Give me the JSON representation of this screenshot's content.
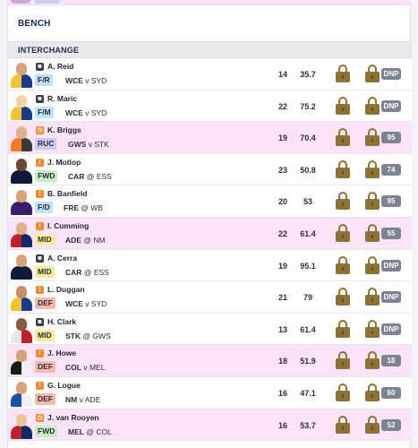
{
  "bench": {
    "label": "BENCH"
  },
  "section": {
    "label": "INTERCHANGE"
  },
  "colors": {
    "row_highlight": "#fbe4f8",
    "lock_gold": "#8c7236",
    "badge_grey": "#7c8392",
    "title_navy": "#1a2a6c"
  },
  "players": [
    {
      "status_icon": "camera-icon",
      "name": "A. Reid",
      "pos": "F/R",
      "pos_key": "FR",
      "team": "WCE",
      "sep": "v",
      "opp": "SYD",
      "rounds": "14",
      "avg": "35.7",
      "badge": "DNP",
      "highlight": false,
      "colors": [
        "#f2c230",
        "#1a3a8a"
      ],
      "skin": "#d9a37a"
    },
    {
      "status_icon": "camera-icon",
      "name": "R. Maric",
      "pos": "F/M",
      "pos_key": "FM",
      "team": "WCE",
      "sep": "v",
      "opp": "SYD",
      "rounds": "22",
      "avg": "75.2",
      "badge": "DNP",
      "highlight": false,
      "colors": [
        "#f2c230",
        "#1a3a8a"
      ],
      "skin": "#f1d3a8"
    },
    {
      "status_icon": "clock-icon",
      "name": "K. Briggs",
      "pos": "RUC",
      "pos_key": "RUC",
      "team": "GWS",
      "sep": "v",
      "opp": "STK",
      "rounds": "19",
      "avg": "70.4",
      "badge": "95",
      "highlight": true,
      "colors": [
        "#f47a20",
        "#3b3b3b"
      ],
      "skin": "#e0b08c"
    },
    {
      "status_icon": "warning-icon",
      "name": "J. Motlop",
      "pos": "FWD",
      "pos_key": "FWD",
      "team": "CAR",
      "sep": "@",
      "opp": "ESS",
      "rounds": "23",
      "avg": "50.8",
      "badge": "74",
      "highlight": false,
      "colors": [
        "#0e1a3a",
        "#0e1a3a"
      ],
      "skin": "#6b4a35"
    },
    {
      "status_icon": "warning-icon",
      "name": "B. Banfield",
      "pos": "F/D",
      "pos_key": "FD",
      "team": "FRE",
      "sep": "@",
      "opp": "WB",
      "rounds": "20",
      "avg": "53",
      "badge": "95",
      "highlight": false,
      "colors": [
        "#3a1e6e",
        "#3a1e6e"
      ],
      "skin": "#d9a37a"
    },
    {
      "status_icon": "warning-icon",
      "name": "I. Cumming",
      "pos": "MID",
      "pos_key": "MID",
      "team": "ADE",
      "sep": "@",
      "opp": "NM",
      "rounds": "22",
      "avg": "61.4",
      "badge": "55",
      "highlight": true,
      "colors": [
        "#c0202a",
        "#0e2a6a"
      ],
      "skin": "#e0b08c"
    },
    {
      "status_icon": "camera-icon",
      "name": "A. Cerra",
      "pos": "MID",
      "pos_key": "MID",
      "team": "CAR",
      "sep": "@",
      "opp": "ESS",
      "rounds": "19",
      "avg": "95.1",
      "badge": "DNP",
      "highlight": false,
      "colors": [
        "#0e1a3a",
        "#0e1a3a"
      ],
      "skin": "#d9a37a"
    },
    {
      "status_icon": "warning-icon",
      "name": "L. Duggan",
      "pos": "DEF",
      "pos_key": "DEF",
      "team": "WCE",
      "sep": "v",
      "opp": "SYD",
      "rounds": "21",
      "avg": "79",
      "badge": "DNP",
      "highlight": false,
      "colors": [
        "#f2c230",
        "#1a3a8a"
      ],
      "skin": "#c98d66"
    },
    {
      "status_icon": "camera-icon",
      "name": "H. Clark",
      "pos": "MID",
      "pos_key": "MID",
      "team": "STK",
      "sep": "@",
      "opp": "GWS",
      "rounds": "13",
      "avg": "61.4",
      "badge": "DNP",
      "highlight": false,
      "colors": [
        "#e8e8e8",
        "#c0202a"
      ],
      "skin": "#8a5b40"
    },
    {
      "status_icon": "warning-icon",
      "name": "J. Howe",
      "pos": "DEF",
      "pos_key": "DEF",
      "team": "COL",
      "sep": "v",
      "opp": "MEL",
      "rounds": "18",
      "avg": "51.9",
      "badge": "18",
      "highlight": true,
      "colors": [
        "#1a1a1a",
        "#f0f0f0"
      ],
      "skin": "#d9a37a"
    },
    {
      "status_icon": "warning-icon",
      "name": "G. Logue",
      "pos": "DEF",
      "pos_key": "DEF",
      "team": "NM",
      "sep": "v",
      "opp": "ADE",
      "rounds": "16",
      "avg": "47.1",
      "badge": "60",
      "highlight": false,
      "colors": [
        "#1b4fa8",
        "#f0f0f0"
      ],
      "skin": "#d9a37a"
    },
    {
      "status_icon": "clock-icon",
      "name": "J. van Rooyen",
      "pos": "FWD",
      "pos_key": "FWD",
      "team": "MEL",
      "sep": "@",
      "opp": "COL",
      "rounds": "16",
      "avg": "53.7",
      "badge": "52",
      "highlight": true,
      "colors": [
        "#c0202a",
        "#0e2a6a"
      ],
      "skin": "#e8c49c"
    }
  ]
}
